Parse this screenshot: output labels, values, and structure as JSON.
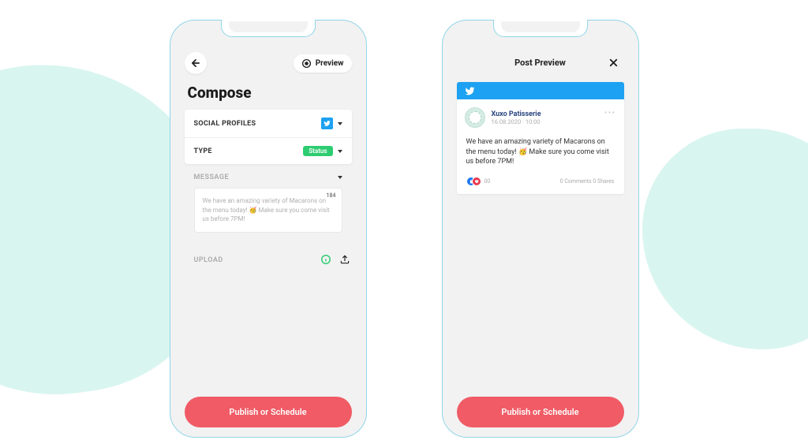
{
  "left": {
    "preview_label": "Preview",
    "title": "Compose",
    "social_profiles_label": "SOCIAL PROFILES",
    "type_label": "TYPE",
    "status_badge": "Status",
    "message_label": "MESSAGE",
    "message_text": "We have an amazing variety of Macarons on the menu today! 🥳 Make sure you come visit us before 7PM!",
    "char_count": "184",
    "upload_label": "UPLOAD",
    "publish_label": "Publish or Schedule"
  },
  "right": {
    "header_title": "Post Preview",
    "author": "Xuxo Patisserie",
    "date": "16.08.2020 · 10:00",
    "body": "We have an amazing variety of Macarons on the menu today! 🥳 Make sure you come visit us before 7PM!",
    "react_count": "00",
    "stats": "0 Comments  0 Shares",
    "publish_label": "Publish or Schedule"
  }
}
